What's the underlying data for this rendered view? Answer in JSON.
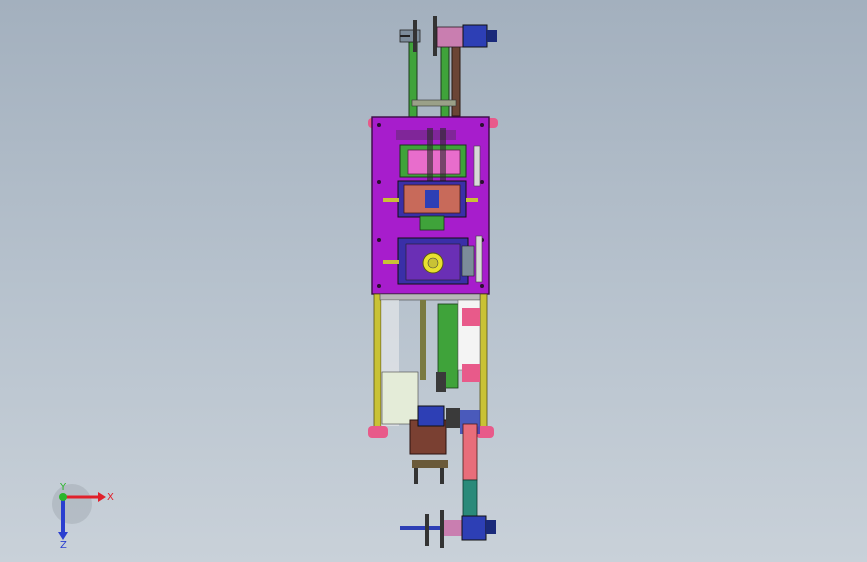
{
  "viewport": {
    "name": "3d-model-viewport"
  },
  "model": {
    "name": "machine-assembly-top-view"
  },
  "triad": {
    "x_label": "X",
    "y_label": "Y",
    "z_label": "Z",
    "x_color": "#e0202a",
    "y_color": "#2bb52b",
    "z_color": "#2a3fd0"
  },
  "colors": {
    "plate": "#a71dcc",
    "frame": "#c9c235",
    "green": "#3fa33a",
    "pink": "#e86dcc",
    "salmon": "#c86a5a",
    "blue": "#3a2fa8",
    "motor": "#2d3fb5",
    "brown": "#7a4032"
  }
}
